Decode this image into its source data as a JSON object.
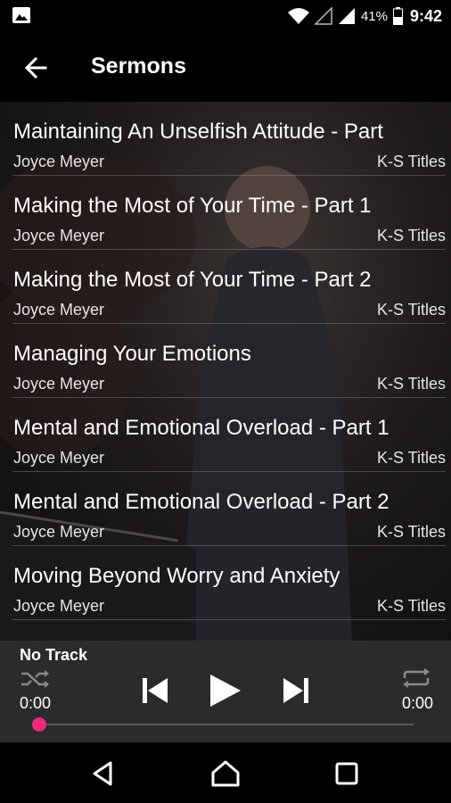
{
  "status_bar": {
    "battery_percent": "41%",
    "time": "9:42",
    "icons": [
      "gallery-icon",
      "wifi-icon",
      "signal-empty-icon",
      "signal-icon",
      "battery-icon"
    ]
  },
  "app_bar": {
    "title": "Sermons",
    "back_icon": "arrow-left-icon"
  },
  "sermons": [
    {
      "title": "Maintaining An Unselfish Attitude - Part",
      "artist": "Joyce Meyer",
      "album": "K-S Titles"
    },
    {
      "title": "Making the Most of Your Time - Part 1",
      "artist": "Joyce Meyer",
      "album": "K-S Titles"
    },
    {
      "title": "Making the Most of Your Time - Part 2",
      "artist": "Joyce Meyer",
      "album": "K-S Titles"
    },
    {
      "title": "Managing Your Emotions",
      "artist": "Joyce Meyer",
      "album": "K-S Titles"
    },
    {
      "title": "Mental and Emotional Overload - Part 1",
      "artist": "Joyce Meyer",
      "album": "K-S Titles"
    },
    {
      "title": "Mental and Emotional Overload - Part 2",
      "artist": "Joyce Meyer",
      "album": "K-S Titles"
    },
    {
      "title": "Moving Beyond Worry and Anxiety",
      "artist": "Joyce Meyer",
      "album": "K-S Titles"
    }
  ],
  "player": {
    "track": "No Track",
    "elapsed": "0:00",
    "duration": "0:00",
    "progress": 0,
    "accent_color": "#ee2a7b",
    "icons": [
      "shuffle-icon",
      "skip-previous-icon",
      "play-icon",
      "skip-next-icon",
      "repeat-icon"
    ]
  },
  "nav_bar": {
    "icons": [
      "nav-back-icon",
      "nav-home-icon",
      "nav-recents-icon"
    ]
  }
}
